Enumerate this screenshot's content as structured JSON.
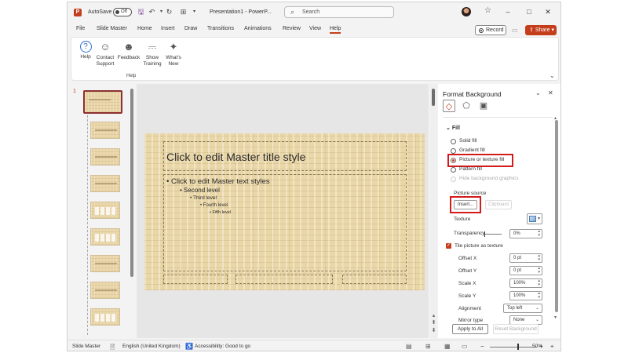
{
  "titlebar": {
    "autosave_label": "AutoSave",
    "autosave_state": "Off",
    "doc_title": "Presentation1 - PowerP...",
    "search_placeholder": "Search"
  },
  "menu": {
    "tabs": [
      "File",
      "Slide Master",
      "Home",
      "Insert",
      "Draw",
      "Transitions",
      "Animations",
      "Review",
      "View",
      "Help"
    ],
    "active_tab": "Help",
    "record_label": "Record",
    "share_label": "Share"
  },
  "ribbon": {
    "buttons": [
      {
        "label": "Help",
        "icon": "help-icon"
      },
      {
        "label": "Contact Support",
        "icon": "contact-support-icon"
      },
      {
        "label": "Feedback",
        "icon": "feedback-icon"
      },
      {
        "label": "Show Training",
        "icon": "show-training-icon"
      },
      {
        "label": "What's New",
        "icon": "whats-new-icon"
      }
    ],
    "group_label": "Help"
  },
  "thumbnails": {
    "selected_number": "1"
  },
  "slide": {
    "title": "Click to edit Master title style",
    "body": [
      "Click to edit Master text styles",
      "Second level",
      "Third level",
      "Fourth level",
      "Fifth level"
    ]
  },
  "format_pane": {
    "title": "Format Background",
    "section": "Fill",
    "fill_options": [
      "Solid fill",
      "Gradient fill",
      "Picture or texture fill",
      "Pattern fill"
    ],
    "selected_fill": "Picture or texture fill",
    "hide_graphics": "Hide background graphics",
    "picture_source": "Picture source",
    "insert_label": "Insert...",
    "clipboard_label": "Clipboard",
    "texture_label": "Texture",
    "transparency_label": "Transparency",
    "transparency_value": "0%",
    "tile_label": "Tile picture as texture",
    "offset_x_label": "Offset X",
    "offset_x_value": "0 pt",
    "offset_y_label": "Offset Y",
    "offset_y_value": "0 pt",
    "scale_x_label": "Scale X",
    "scale_x_value": "100%",
    "scale_y_label": "Scale Y",
    "scale_y_value": "100%",
    "alignment_label": "Alignment",
    "alignment_value": "Top left",
    "mirror_label": "Mirror type",
    "mirror_value": "None",
    "apply_all": "Apply to All",
    "reset": "Reset Background"
  },
  "statusbar": {
    "view": "Slide Master",
    "language": "English (United Kingdom)",
    "accessibility": "Accessibility: Good to go",
    "zoom": "50%"
  },
  "colors": {
    "accent": "#c43e1c",
    "highlight": "#d31b1b"
  }
}
